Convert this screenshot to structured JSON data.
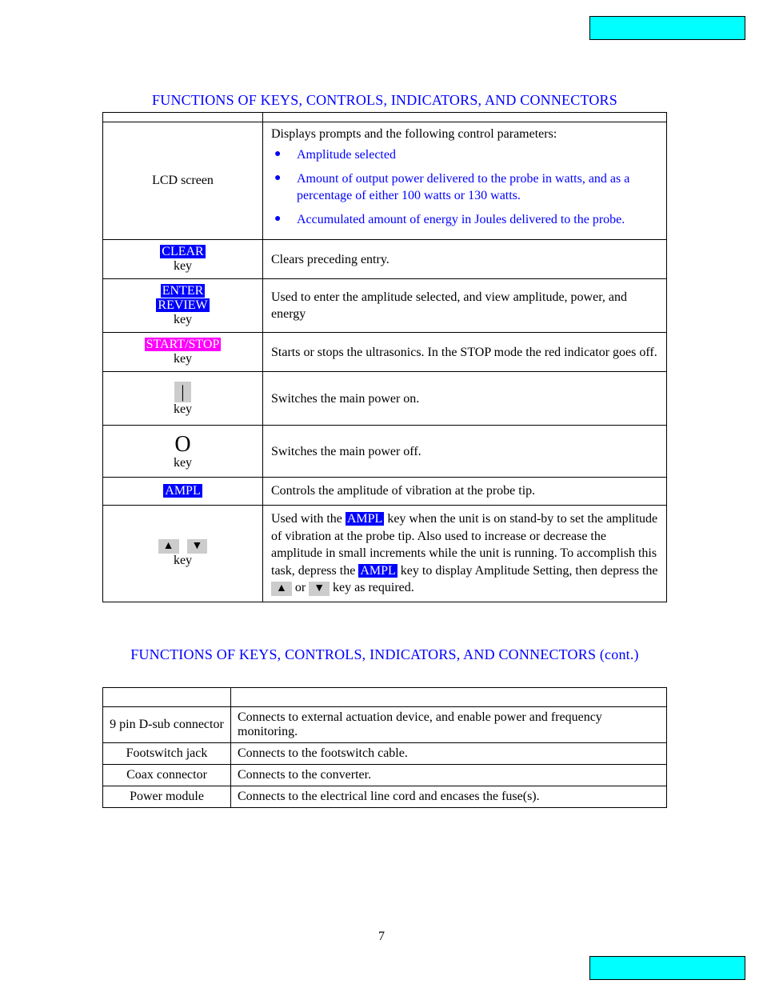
{
  "heading1": "FUNCTIONS OF KEYS, CONTROLS, INDICATORS, AND CONNECTORS",
  "heading2": "FUNCTIONS OF KEYS, CONTROLS, INDICATORS, AND CONNECTORS (cont.)",
  "lcd": {
    "label": "LCD screen",
    "intro": "Displays prompts and the following control parameters:",
    "bullets": [
      "Amplitude selected",
      "Amount of output power delivered to the probe in watts, and as a percentage of either 100 watts or 130 watts.",
      "Accumulated amount of energy in Joules delivered to the probe."
    ]
  },
  "rows": {
    "clear": {
      "tag": "CLEAR",
      "sub": "key",
      "desc": "Clears preceding entry."
    },
    "enter_review": {
      "tag1": "ENTER",
      "tag2": "REVIEW",
      "sub": "key",
      "desc": "Used to enter the amplitude selected, and view amplitude, power, and energy"
    },
    "startstop": {
      "tag": "START/STOP",
      "sub": "key",
      "desc": "Starts or stops the ultrasonics. In the STOP mode the red indicator goes off."
    },
    "power_on": {
      "symbol": "|",
      "sub": "key",
      "desc": "Switches the main power on."
    },
    "power_off": {
      "symbol": "O",
      "sub": "key",
      "desc": "Switches the main power off."
    },
    "ampl": {
      "tag": "AMPL",
      "desc": "Controls the amplitude of vibration at the probe tip."
    },
    "arrows": {
      "up": "▲",
      "down": "▼",
      "sub": "key",
      "desc_pre": "Used with the ",
      "ampl_tag": "AMPL",
      "desc_mid": " key when the unit is on stand-by to set the amplitude of vibration at the probe tip. Also used to increase or decrease the amplitude in small increments while the unit is running. To accomplish this task, depress the ",
      "desc_mid2": " key to display Amplitude Setting, then depress the ",
      "or": " or ",
      "desc_end": " key as required."
    }
  },
  "table2": {
    "r1": {
      "name": "9 pin D-sub connector",
      "desc": "Connects to external actuation device, and enable power and frequency monitoring."
    },
    "r2": {
      "name": "Footswitch jack",
      "desc": "Connects to the footswitch cable."
    },
    "r3": {
      "name": "Coax connector",
      "desc": "Connects to the converter."
    },
    "r4": {
      "name": "Power module",
      "desc": "Connects to the electrical line cord and encases the fuse(s)."
    }
  },
  "page_number": "7"
}
